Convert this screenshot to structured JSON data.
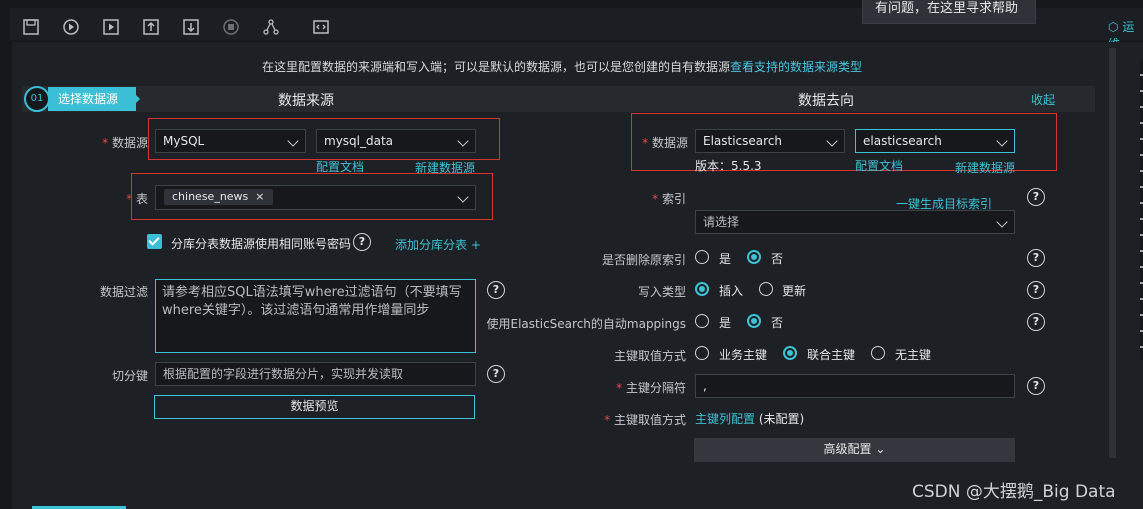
{
  "tooltip": {
    "text": "有问题，在这里寻求帮助"
  },
  "toolbar": {
    "icons": [
      "save-icon",
      "run-icon",
      "play-box-icon",
      "upload-icon",
      "download-icon",
      "stop-icon",
      "share-icon",
      "code-icon"
    ],
    "right_label": "运维"
  },
  "intro": {
    "text": "在这里配置数据的来源端和写入端；可以是默认的数据源，也可以是您创建的自有数据源",
    "link": "查看支持的数据来源类型"
  },
  "step": {
    "number": "01",
    "label": "选择数据源"
  },
  "source": {
    "title": "数据来源",
    "datasource_label": "数据源",
    "datasource_type": "MySQL",
    "datasource_name": "mysql_data",
    "doc_link": "配置文档",
    "new_link": "新建数据源",
    "table_label": "表",
    "table_tag": "chinese_news",
    "tag_close": "×",
    "same_account_label": "分库分表数据源使用相同账号密码",
    "add_shard_link": "添加分库分表 +",
    "filter_label": "数据过滤",
    "filter_placeholder": "请参考相应SQL语法填写where过滤语句（不要填写where关键字）。该过滤语句通常用作增量同步",
    "split_label": "切分键",
    "split_placeholder": "根据配置的字段进行数据分片，实现并发读取",
    "preview_button": "数据预览"
  },
  "target": {
    "title": "数据去向",
    "collapse": "收起",
    "datasource_label": "数据源",
    "datasource_type": "Elasticsearch",
    "datasource_name": "elasticsearch",
    "version": "版本：5.5.3",
    "doc_link": "配置文档",
    "new_link": "新建数据源",
    "index_label": "索引",
    "gen_index_link": "一键生成目标索引",
    "index_placeholder": "请选择",
    "delete_index_label": "是否删除原索引",
    "write_type_label": "写入类型",
    "mappings_label": "使用ElasticSearch的自动mappings",
    "pk_mode_label": "主键取值方式",
    "pk_sep_label": "主键分隔符",
    "pk_sep_value": ",",
    "pk_mode2_label": "主键取值方式",
    "pk_column_link": "主键列配置",
    "pk_column_status": "(未配置)",
    "advanced_button": "高级配置",
    "yes": "是",
    "no": "否",
    "insert": "插入",
    "update": "更新",
    "biz_key": "业务主键",
    "union_key": "联合主键",
    "no_key": "无主键"
  },
  "watermark": "CSDN @大摆鹅_Big Data",
  "qm": "?"
}
